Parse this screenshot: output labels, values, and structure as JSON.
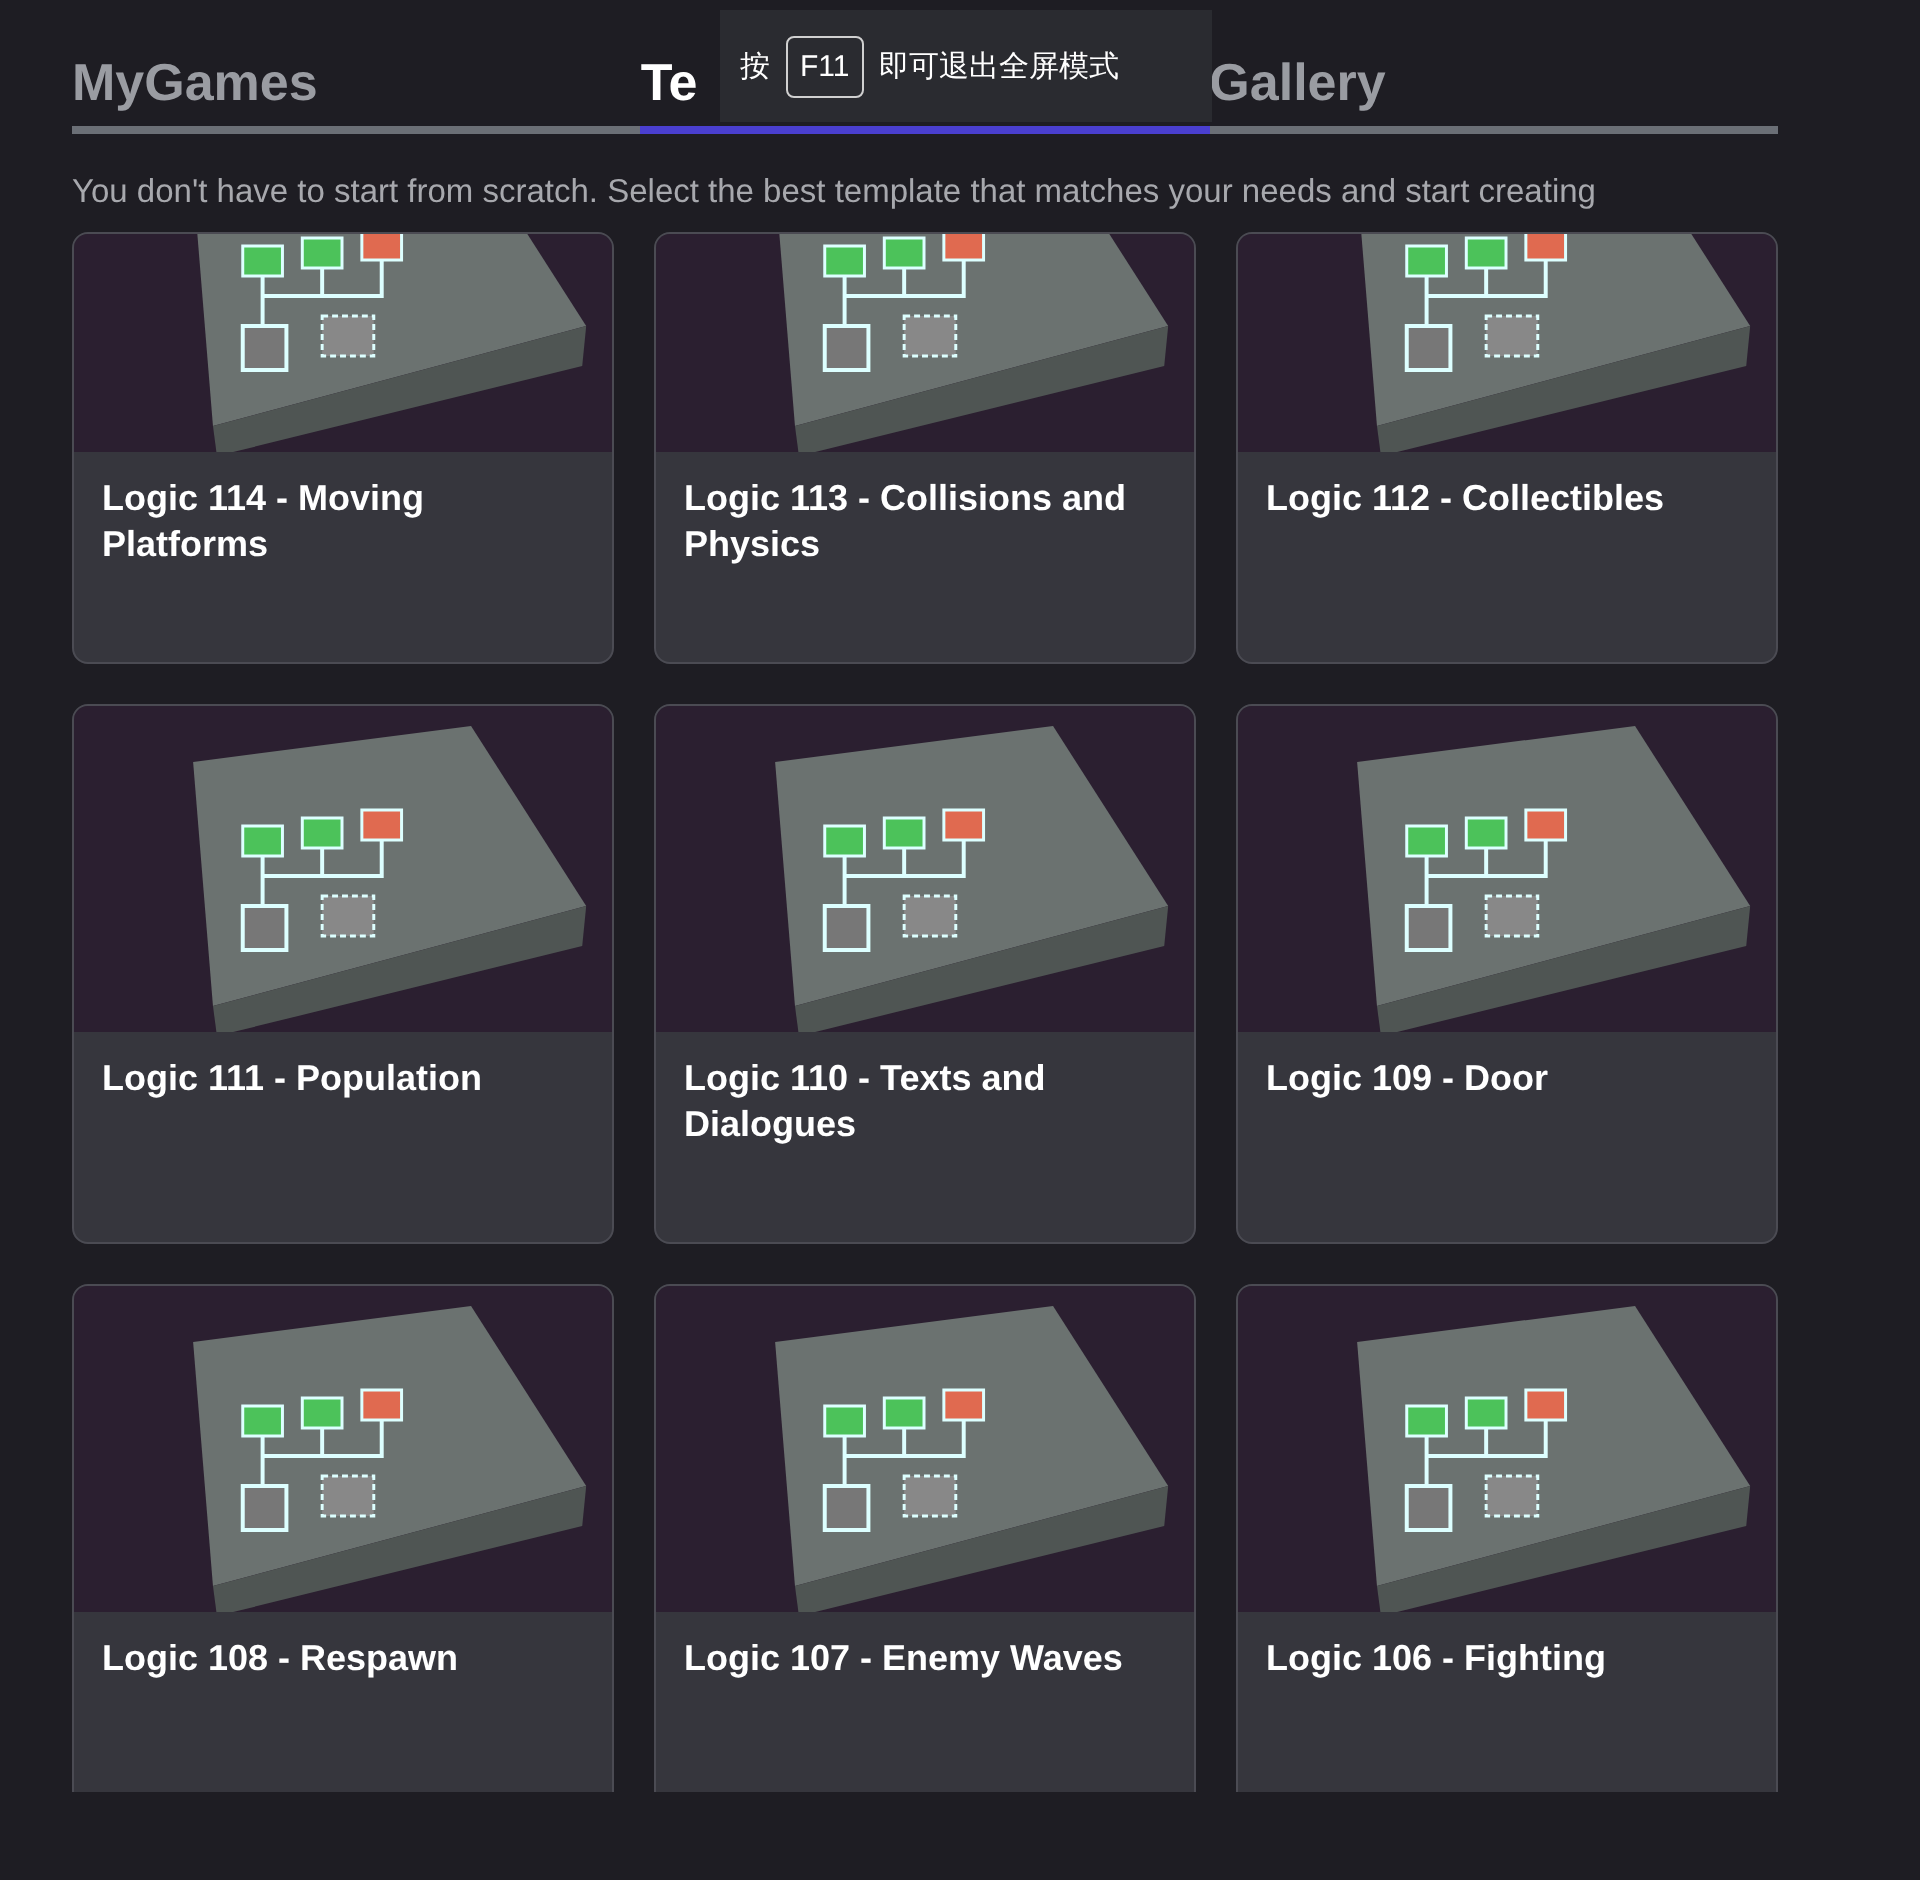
{
  "tabs": [
    {
      "label": "MyGames",
      "selected": false
    },
    {
      "label": "Te",
      "selected": true
    },
    {
      "label": "Gallery",
      "selected": false
    }
  ],
  "toast": {
    "before": "按",
    "key": "F11",
    "after": "即可退出全屏模式"
  },
  "description": "You don't have to start from scratch. Select the best template that matches your needs and start creating",
  "templates": [
    {
      "title": "Logic 114 - Moving Platforms"
    },
    {
      "title": "Logic 113 - Collisions and Physics"
    },
    {
      "title": "Logic 112 - Collectibles"
    },
    {
      "title": "Logic 111 - Population"
    },
    {
      "title": "Logic 110 - Texts and Dialogues"
    },
    {
      "title": "Logic 109 - Door"
    },
    {
      "title": "Logic 108 - Respawn"
    },
    {
      "title": "Logic 107 - Enemy Waves"
    },
    {
      "title": "Logic 106 - Fighting"
    }
  ]
}
